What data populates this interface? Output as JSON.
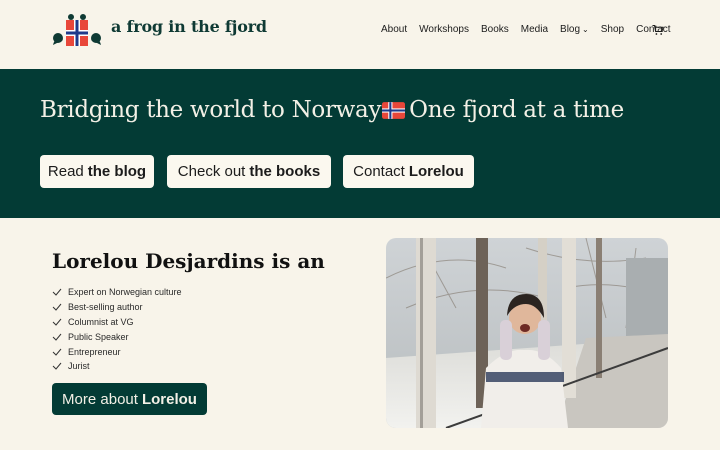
{
  "header": {
    "brand": "a frog in the fjord",
    "nav": [
      {
        "label": "About"
      },
      {
        "label": "Workshops"
      },
      {
        "label": "Books"
      },
      {
        "label": "Media"
      },
      {
        "label": "Blog"
      },
      {
        "label": "Shop"
      },
      {
        "label": "Contact"
      }
    ],
    "icons": {
      "cart": "cart-icon",
      "dropdown": "chevron-down-icon"
    }
  },
  "hero": {
    "title_part1": "Bridging the world to Norway",
    "title_part2": "One fjord at a time",
    "buttons": [
      {
        "prefix": "Read",
        "bold": "the blog"
      },
      {
        "prefix": "Check out",
        "bold": "the books"
      },
      {
        "prefix": "Contact",
        "bold": "Lorelou"
      }
    ]
  },
  "bio": {
    "name": "Lorelou Desjardins",
    "suffix": "is an",
    "items": [
      "Expert on Norwegian culture",
      "Best-selling author",
      "Columnist at VG",
      "Public Speaker",
      "Entrepreneur",
      "Jurist"
    ],
    "button": {
      "prefix": "More about",
      "bold": "Lorelou"
    }
  },
  "colors": {
    "background": "#f8f4ea",
    "brand_green": "#033b35",
    "flag_red": "#e8473a",
    "flag_blue": "#1f3a8a"
  }
}
